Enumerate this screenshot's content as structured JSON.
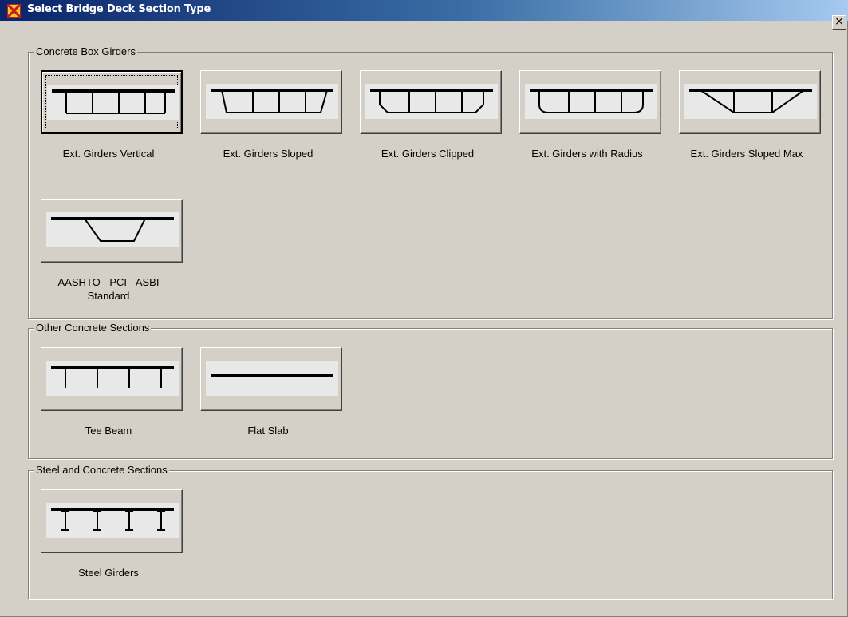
{
  "window": {
    "title": "Select Bridge Deck Section Type",
    "close_label": "×"
  },
  "groups": {
    "box": {
      "legend": "Concrete Box Girders",
      "items": [
        {
          "label": "Ext. Girders Vertical",
          "icon": "box-girder-vertical-icon"
        },
        {
          "label": "Ext. Girders Sloped",
          "icon": "box-girder-sloped-icon"
        },
        {
          "label": "Ext. Girders Clipped",
          "icon": "box-girder-clipped-icon"
        },
        {
          "label": "Ext. Girders with Radius",
          "icon": "box-girder-radius-icon"
        },
        {
          "label": "Ext. Girders Sloped Max",
          "icon": "box-girder-sloped-max-icon"
        },
        {
          "label": "AASHTO - PCI - ASBI\nStandard",
          "icon": "aashto-pci-asbi-icon"
        }
      ]
    },
    "other": {
      "legend": "Other Concrete Sections",
      "items": [
        {
          "label": "Tee Beam",
          "icon": "tee-beam-icon"
        },
        {
          "label": "Flat Slab",
          "icon": "flat-slab-icon"
        }
      ]
    },
    "steel": {
      "legend": "Steel and Concrete Sections",
      "items": [
        {
          "label": "Steel Girders",
          "icon": "steel-girders-icon"
        }
      ]
    }
  },
  "selected": "Ext. Girders Vertical"
}
